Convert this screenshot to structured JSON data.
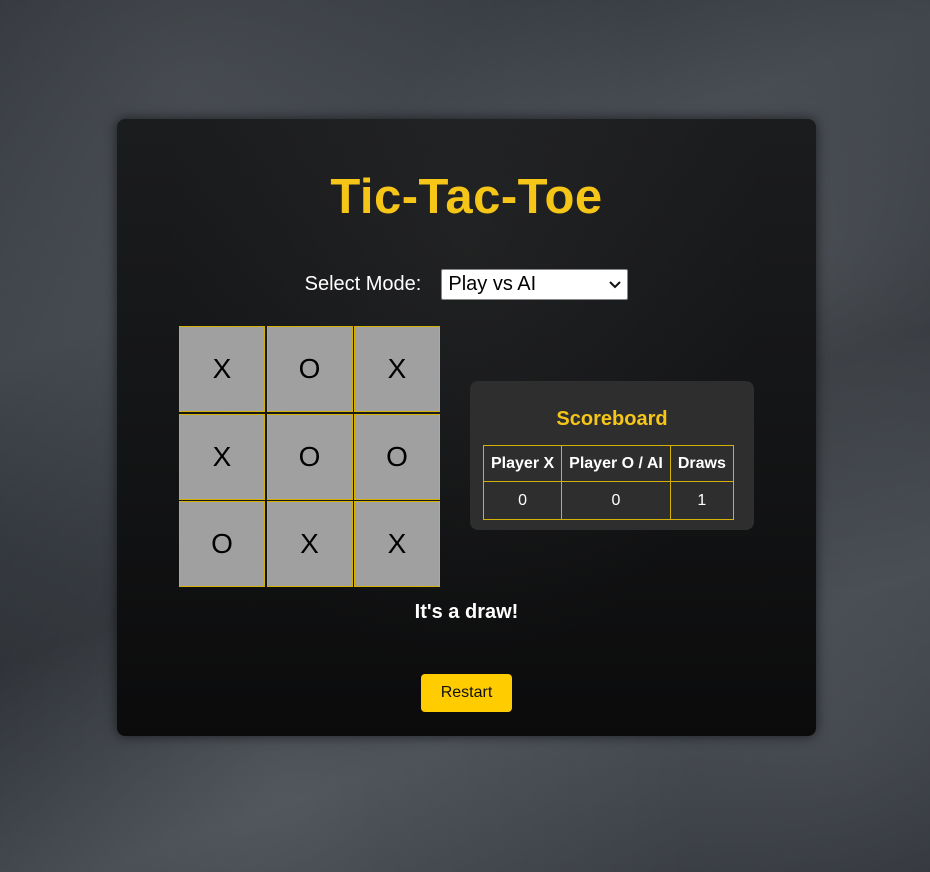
{
  "title": "Tic-Tac-Toe",
  "mode": {
    "label": "Select Mode:",
    "selected": "Play vs AI"
  },
  "board": {
    "cells": [
      "X",
      "O",
      "X",
      "X",
      "O",
      "O",
      "O",
      "X",
      "X"
    ]
  },
  "scoreboard": {
    "title": "Scoreboard",
    "headers": [
      "Player X",
      "Player O / AI",
      "Draws"
    ],
    "values": [
      "0",
      "0",
      "1"
    ]
  },
  "status": "It's a draw!",
  "restart_label": "Restart",
  "colors": {
    "accent": "#f5c518",
    "button": "#ffcc00",
    "cell_bg": "#a0a0a0",
    "cell_border": "#d4b106"
  }
}
